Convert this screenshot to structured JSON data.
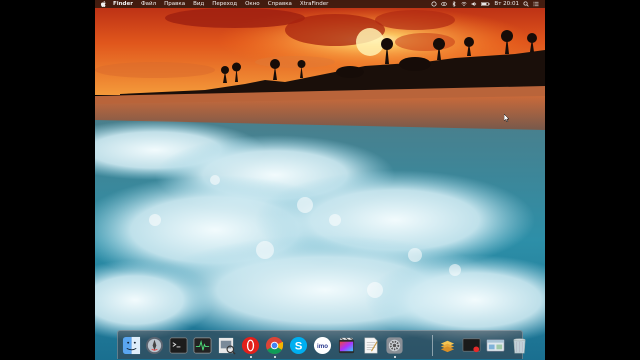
{
  "menubar": {
    "app_name": "Finder",
    "items": [
      "Файл",
      "Правка",
      "Вид",
      "Переход",
      "Окно",
      "Справка",
      "XtraFinder"
    ],
    "clock": "Вт 20:01",
    "status_icons": [
      "circle-status-icon",
      "eye-icon",
      "bluetooth-icon",
      "wifi-icon",
      "volume-icon",
      "battery-icon"
    ]
  },
  "dock": {
    "apps": [
      {
        "name": "finder-icon"
      },
      {
        "name": "launchpad-icon"
      },
      {
        "name": "terminal-icon"
      },
      {
        "name": "activity-monitor-icon"
      },
      {
        "name": "preview-icon"
      },
      {
        "name": "opera-icon"
      },
      {
        "name": "chrome-icon"
      },
      {
        "name": "skype-icon",
        "glyph": "S"
      },
      {
        "name": "imo-icon",
        "glyph": "imo"
      },
      {
        "name": "final-cut-icon"
      },
      {
        "name": "textedit-icon"
      },
      {
        "name": "system-preferences-icon"
      },
      {
        "name": "downloads-stack-icon"
      },
      {
        "name": "screen-recorder-icon"
      },
      {
        "name": "xtrafinder-window-icon"
      },
      {
        "name": "trash-icon"
      }
    ]
  },
  "colors": {
    "sky_top": "#c0331a",
    "sun": "#ffe79a",
    "sea": "#2f6f86",
    "foam": "#e6f6fb"
  }
}
